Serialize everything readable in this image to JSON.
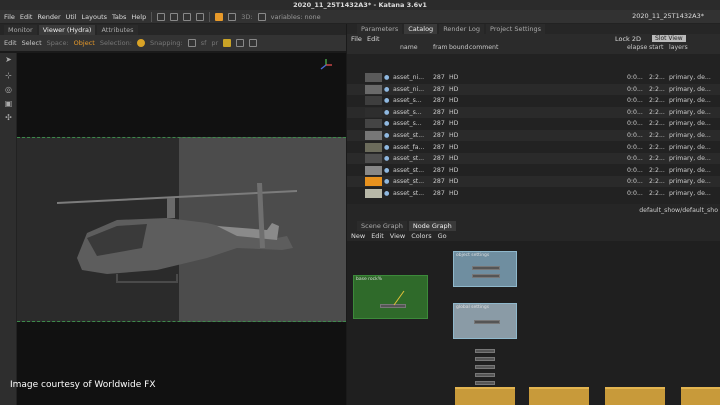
{
  "window": {
    "title": "2020_11_25T1432A3* - Katana 3.6v1"
  },
  "menubar": {
    "items": [
      "File",
      "Edit",
      "Render",
      "Util",
      "Layouts",
      "Tabs",
      "Help"
    ],
    "view_3d": "3D:",
    "variables": "variables: none",
    "project": "2020_11_25T1432A3*"
  },
  "viewer": {
    "tabs": [
      "Monitor",
      "Viewer (Hydra)",
      "Attributes"
    ],
    "toolbar": {
      "edit": "Edit",
      "select": "Select",
      "space_label": "Space:",
      "space_value": "Object",
      "selection_label": "Selection:",
      "snapping_label": "Snapping:",
      "sf": "sf",
      "pr": "pr"
    },
    "credit": "Image courtesy of Worldwide FX"
  },
  "right": {
    "tabs": [
      "Parameters",
      "Catalog",
      "Render Log",
      "Project Settings"
    ],
    "catalog": {
      "menu": [
        "File",
        "Edit"
      ],
      "lock2d": "Lock 2D",
      "slot_view": "Slot View",
      "headers": {
        "name": "name",
        "frame": "fram",
        "bound": "bound",
        "comment": "comment",
        "elapsed": "elapse",
        "start": "start",
        "layers": "layers"
      },
      "rows": [
        {
          "name": "asset_ni...",
          "frame": "287",
          "bound": "HD",
          "elapsed": "0:0...",
          "start": "2:2...",
          "layers": "primary, de..."
        },
        {
          "name": "asset_ni...",
          "frame": "287",
          "bound": "HD",
          "elapsed": "0:0...",
          "start": "2:2...",
          "layers": "primary, de..."
        },
        {
          "name": "asset_s...",
          "frame": "287",
          "bound": "HD",
          "elapsed": "0:0...",
          "start": "2:2...",
          "layers": "primary, de..."
        },
        {
          "name": "asset_s...",
          "frame": "287",
          "bound": "HD",
          "elapsed": "0:0...",
          "start": "2:2...",
          "layers": "primary, de..."
        },
        {
          "name": "asset_s...",
          "frame": "287",
          "bound": "HD",
          "elapsed": "0:0...",
          "start": "2:2...",
          "layers": "primary, de..."
        },
        {
          "name": "asset_st...",
          "frame": "287",
          "bound": "HD",
          "elapsed": "0:0...",
          "start": "2:2...",
          "layers": "primary, de..."
        },
        {
          "name": "asset_fa...",
          "frame": "287",
          "bound": "HD",
          "elapsed": "0:0...",
          "start": "2:2...",
          "layers": "primary, de..."
        },
        {
          "name": "asset_st...",
          "frame": "287",
          "bound": "HD",
          "elapsed": "0:0...",
          "start": "2:2...",
          "layers": "primary, de..."
        },
        {
          "name": "asset_st...",
          "frame": "287",
          "bound": "HD",
          "elapsed": "0:0...",
          "start": "2:2...",
          "layers": "primary, de..."
        },
        {
          "name": "asset_st...",
          "frame": "287",
          "bound": "HD",
          "elapsed": "0:0...",
          "start": "2:2...",
          "layers": "primary, de..."
        },
        {
          "name": "asset_st...",
          "frame": "287",
          "bound": "HD",
          "elapsed": "0:0...",
          "start": "2:2...",
          "layers": "primary, de..."
        }
      ],
      "footer": "default_show/default_sho"
    },
    "node_graph": {
      "tabs": [
        "Scene Graph",
        "Node Graph"
      ],
      "menu": [
        "New",
        "Edit",
        "View",
        "Colors",
        "Go"
      ],
      "backdrops": [
        "object settings",
        "base rock%",
        "global settings"
      ]
    }
  },
  "colors": {
    "accent_orange": "#e89a2a",
    "backdrop_green": "#2f6a2a",
    "backdrop_blue": "#6f8ea0",
    "node_orange": "#c89a3a"
  }
}
